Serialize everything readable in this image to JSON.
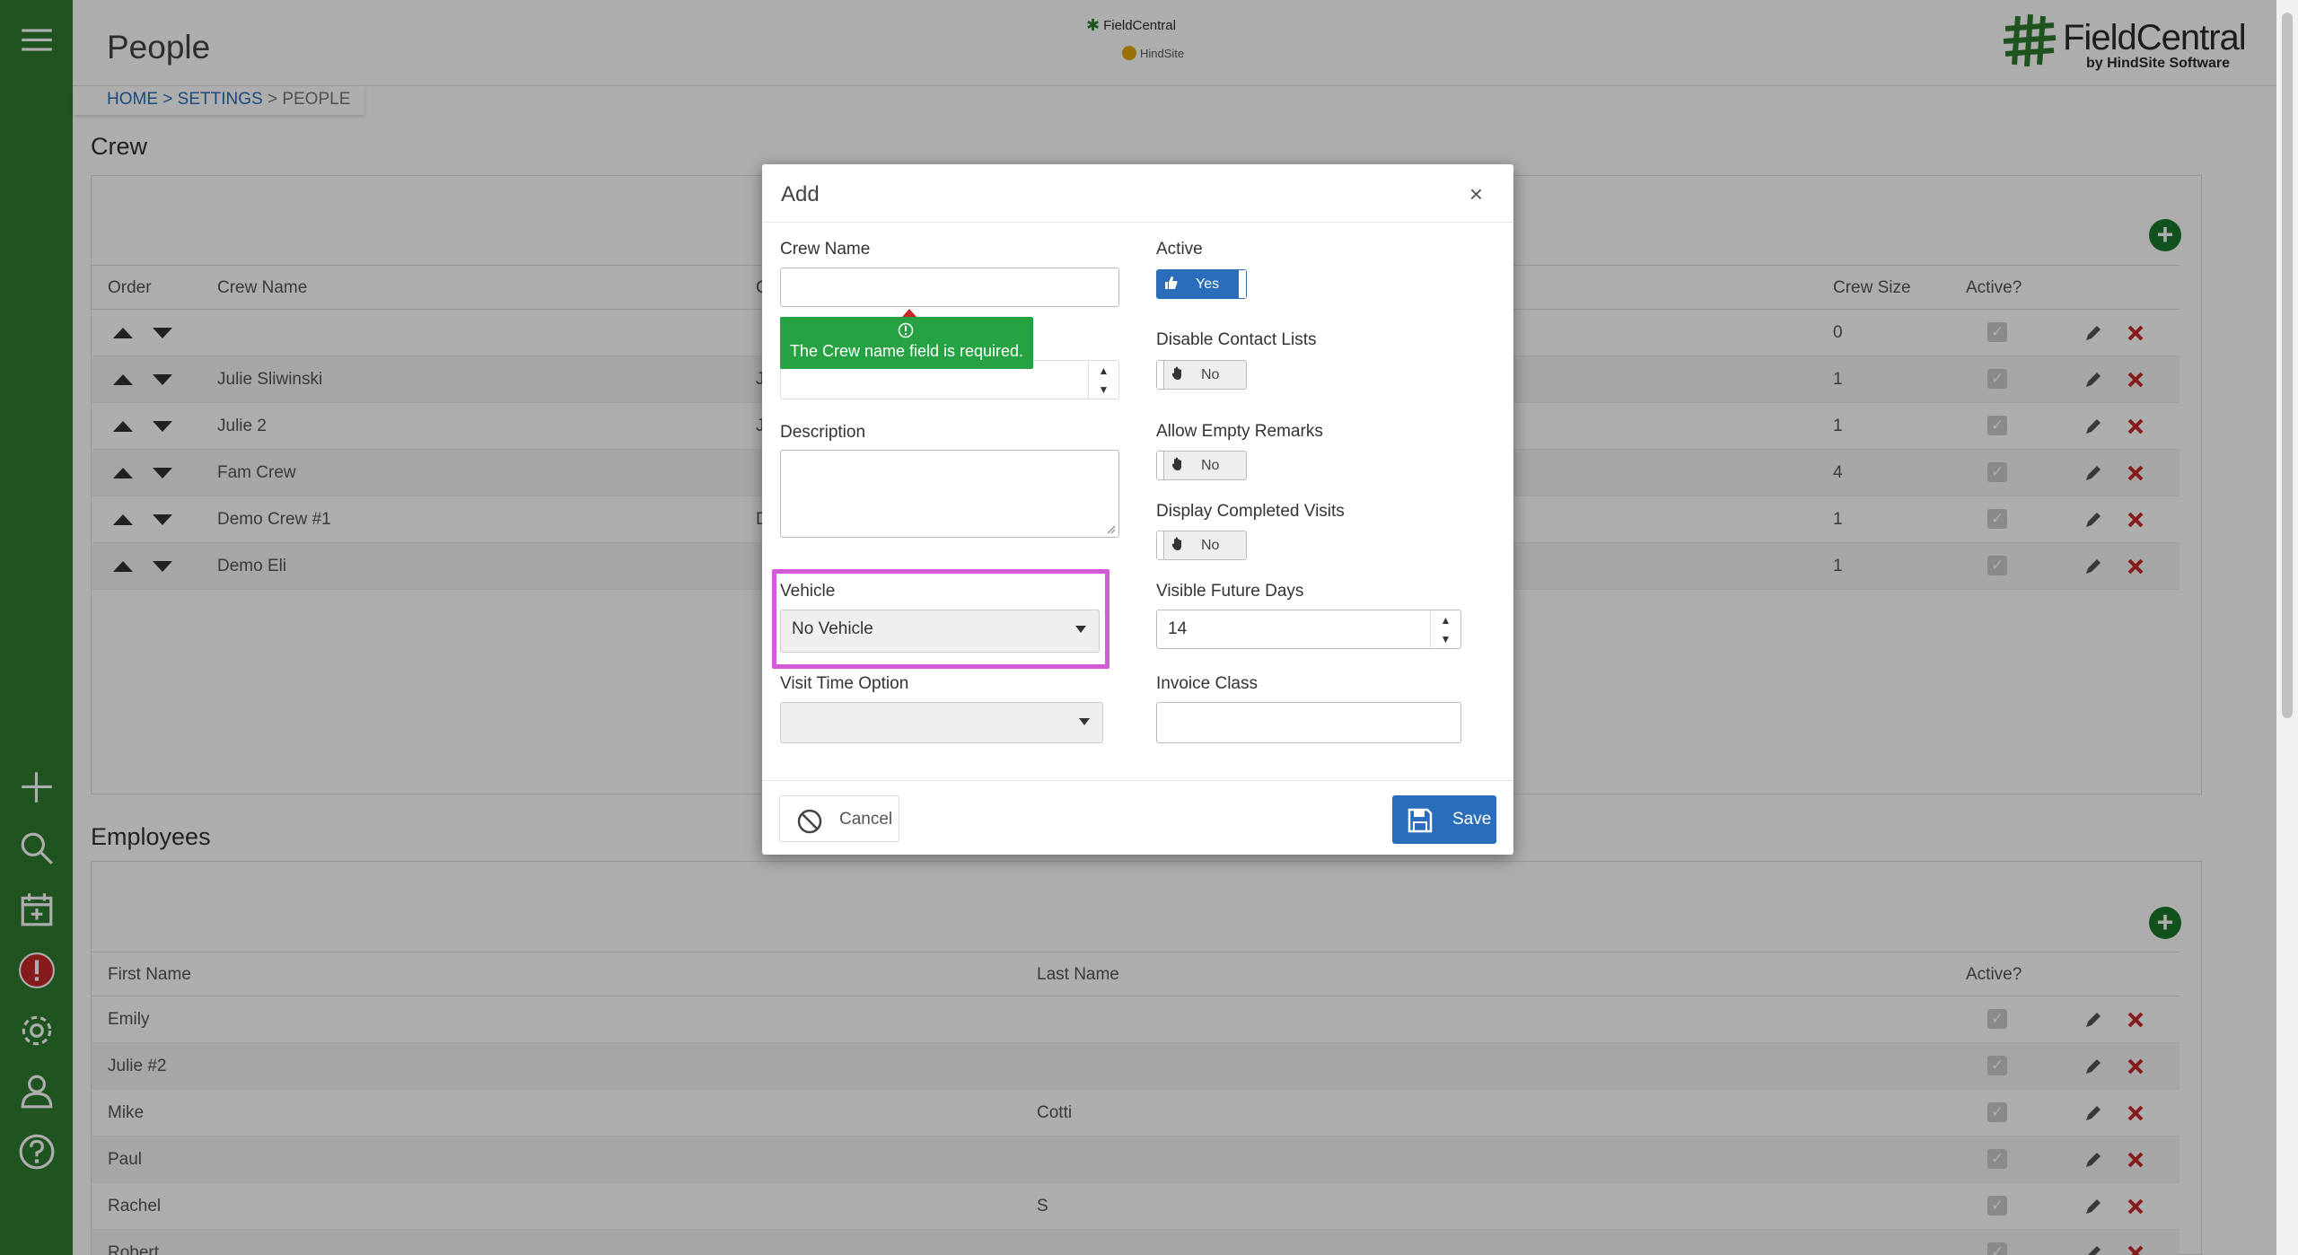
{
  "page": {
    "title": "People"
  },
  "mini_logo": {
    "line1": "FieldCentral",
    "line2": "HindSite"
  },
  "brand": {
    "name": "FieldCentral",
    "sub": "by HindSite Software"
  },
  "breadcrumb": {
    "home": "HOME",
    "sep1": " > ",
    "settings": "SETTINGS",
    "sep2": " > ",
    "current": "PEOPLE"
  },
  "crew": {
    "title": "Crew",
    "headers": {
      "order": "Order",
      "name": "Crew Name",
      "col3": "C",
      "size": "Crew Size",
      "active": "Active?"
    },
    "rows": [
      {
        "name": "",
        "col3": "",
        "size": "0"
      },
      {
        "name": "Julie Sliwinski",
        "col3": "J",
        "size": "1"
      },
      {
        "name": "Julie 2",
        "col3": "J",
        "size": "1"
      },
      {
        "name": "Fam Crew",
        "col3": "",
        "size": "4"
      },
      {
        "name": "Demo Crew #1",
        "col3": "D",
        "size": "1"
      },
      {
        "name": "Demo Eli",
        "col3": "",
        "size": "1"
      }
    ]
  },
  "employees": {
    "title": "Employees",
    "headers": {
      "first": "First Name",
      "last": "Last Name",
      "active": "Active?"
    },
    "rows": [
      {
        "first": "Emily",
        "last": ""
      },
      {
        "first": "Julie #2",
        "last": ""
      },
      {
        "first": "Mike",
        "last": "Cotti"
      },
      {
        "first": "Paul",
        "last": ""
      },
      {
        "first": "Rachel",
        "last": "S"
      },
      {
        "first": "Robert",
        "last": ""
      }
    ]
  },
  "modal": {
    "title": "Add",
    "close": "×",
    "crew_name_label": "Crew Name",
    "crew_name_value": "",
    "tooltip": "The Crew name field is required.",
    "description_label": "Description",
    "vehicle_label": "Vehicle",
    "vehicle_value": "No Vehicle",
    "visit_time_label": "Visit Time Option",
    "visit_time_value": "",
    "active_label": "Active",
    "active_value": "Yes",
    "disable_contact_label": "Disable Contact Lists",
    "disable_contact_value": "No",
    "allow_empty_label": "Allow Empty Remarks",
    "allow_empty_value": "No",
    "display_completed_label": "Display Completed Visits",
    "display_completed_value": "No",
    "future_days_label": "Visible Future Days",
    "future_days_value": "14",
    "invoice_class_label": "Invoice Class",
    "invoice_class_value": "",
    "cancel": "Cancel",
    "save": "Save"
  },
  "colors": {
    "sidebar": "#2e7d32",
    "primary": "#2a6ebb",
    "tooltip": "#27a243",
    "highlight": "#d35bd6",
    "alert": "#c62828"
  },
  "icons": [
    "menu-icon",
    "plus-icon",
    "search-icon",
    "calendar-add-icon",
    "alert-icon",
    "gear-icon",
    "user-icon",
    "help-icon",
    "edit-icon",
    "delete-icon",
    "add-circle-icon",
    "thumbs-up-icon",
    "hand-icon",
    "ban-icon",
    "save-icon"
  ]
}
